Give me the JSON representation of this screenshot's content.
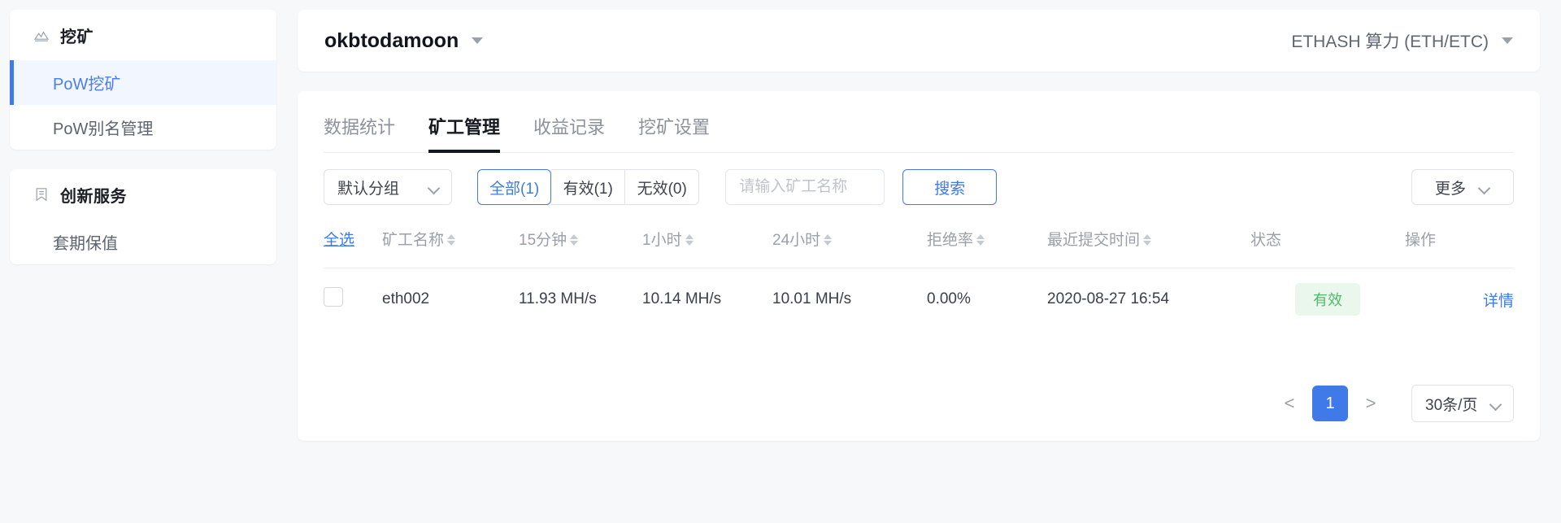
{
  "sidebar": {
    "groups": [
      {
        "icon": "mountain-icon",
        "label": "挖矿",
        "items": [
          {
            "label": "PoW挖矿",
            "active": true
          },
          {
            "label": "PoW别名管理",
            "active": false
          }
        ]
      },
      {
        "icon": "bookmark-icon",
        "label": "创新服务",
        "items": [
          {
            "label": "套期保值",
            "active": false
          }
        ]
      }
    ]
  },
  "topbar": {
    "account": "okbtodamoon",
    "algorithm": "ETHASH 算力 (ETH/ETC)"
  },
  "tabs": [
    {
      "label": "数据统计",
      "active": false
    },
    {
      "label": "矿工管理",
      "active": true
    },
    {
      "label": "收益记录",
      "active": false
    },
    {
      "label": "挖矿设置",
      "active": false
    }
  ],
  "filters": {
    "group_select": "默认分组",
    "segments": [
      {
        "label": "全部(1)",
        "active": true
      },
      {
        "label": "有效(1)",
        "active": false
      },
      {
        "label": "无效(0)",
        "active": false
      }
    ],
    "search_value": "",
    "search_placeholder": "请输入矿工名称",
    "search_button": "搜索",
    "more_button": "更多"
  },
  "table": {
    "select_all": "全选",
    "columns": [
      {
        "label": "矿工名称",
        "sortable": true
      },
      {
        "label": "15分钟",
        "sortable": true
      },
      {
        "label": "1小时",
        "sortable": true
      },
      {
        "label": "24小时",
        "sortable": true
      },
      {
        "label": "拒绝率",
        "sortable": true
      },
      {
        "label": "最近提交时间",
        "sortable": true
      },
      {
        "label": "状态",
        "sortable": false
      },
      {
        "label": "操作",
        "sortable": false
      }
    ],
    "rows": [
      {
        "checked": false,
        "name": "eth002",
        "m15": "11.93 MH/s",
        "h1": "10.14 MH/s",
        "h24": "10.01 MH/s",
        "reject": "0.00%",
        "last_submit": "2020-08-27 16:54",
        "status": "有效",
        "action": "详情"
      }
    ]
  },
  "pagination": {
    "prev": "<",
    "next": ">",
    "pages": [
      "1"
    ],
    "current_page": "1",
    "page_size": "30条/页"
  },
  "colors": {
    "accent": "#3f7ae8",
    "accent_soft": "#f2f6fe",
    "page_bg": "#f7f8fa",
    "status_green_text": "#52b96b",
    "status_green_bg": "#e9f7ed"
  }
}
